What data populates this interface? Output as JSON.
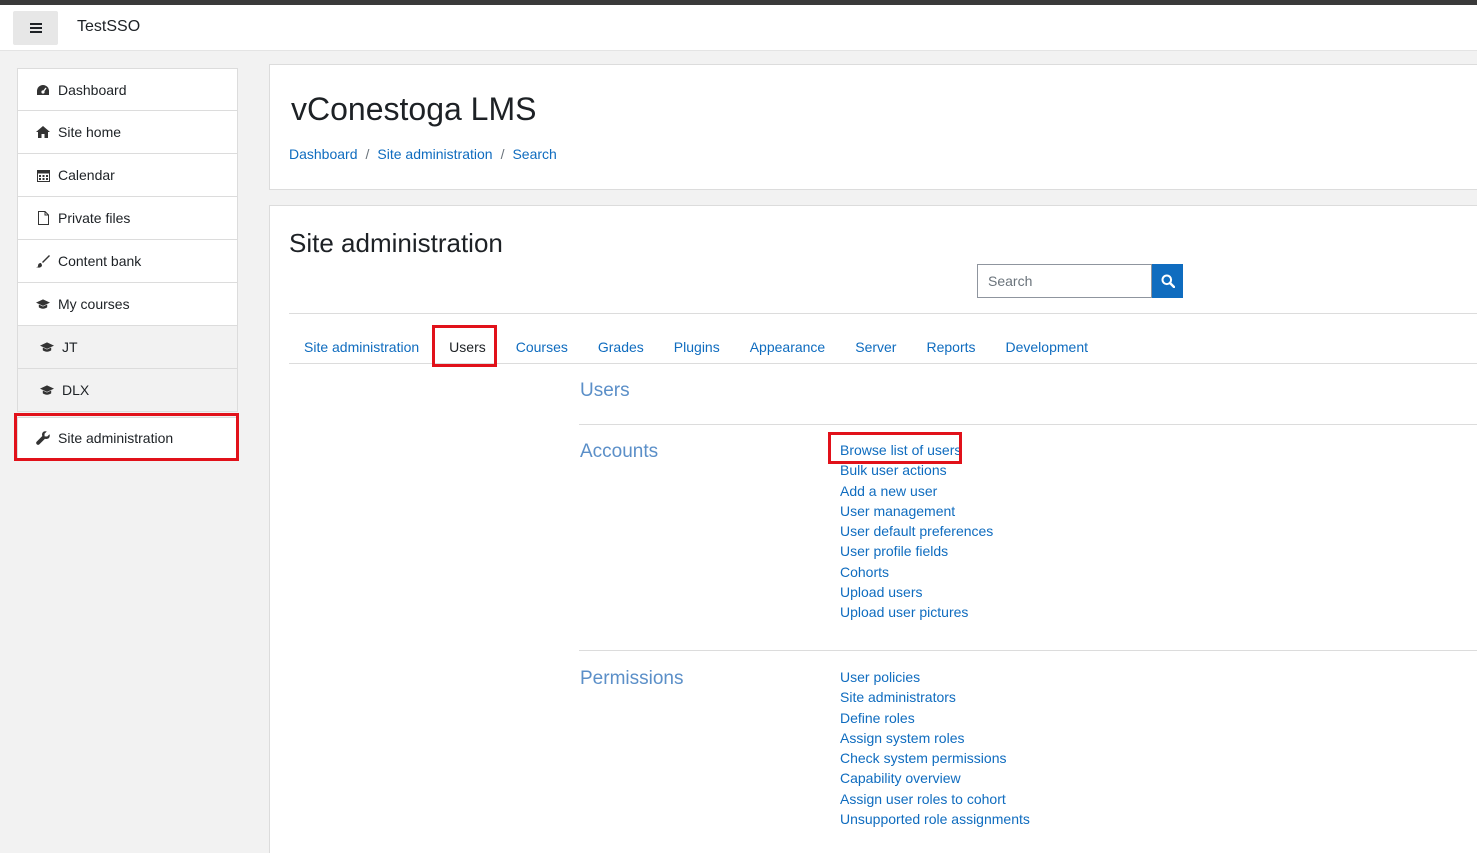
{
  "navbar": {
    "menu_icon": "hamburger-menu-icon",
    "site_name": "TestSSO"
  },
  "sidebar": {
    "items": [
      {
        "label": "Dashboard",
        "icon": "dashboard-icon"
      },
      {
        "label": "Site home",
        "icon": "home-icon"
      },
      {
        "label": "Calendar",
        "icon": "calendar-icon"
      },
      {
        "label": "Private files",
        "icon": "file-icon"
      },
      {
        "label": "Content bank",
        "icon": "paintbrush-icon"
      },
      {
        "label": "My courses",
        "icon": "graduation-cap-icon"
      },
      {
        "label": "JT",
        "icon": "graduation-cap-icon"
      },
      {
        "label": "DLX",
        "icon": "graduation-cap-icon"
      },
      {
        "label": "Site administration",
        "icon": "wrench-icon"
      }
    ]
  },
  "header": {
    "title": "vConestoga LMS",
    "breadcrumb": [
      "Dashboard",
      "Site administration",
      "Search"
    ]
  },
  "main": {
    "title": "Site administration",
    "search": {
      "placeholder": "Search",
      "button_icon": "search-icon"
    },
    "tabs": [
      {
        "label": "Site administration"
      },
      {
        "label": "Users",
        "active": true
      },
      {
        "label": "Courses"
      },
      {
        "label": "Grades"
      },
      {
        "label": "Plugins"
      },
      {
        "label": "Appearance"
      },
      {
        "label": "Server"
      },
      {
        "label": "Reports"
      },
      {
        "label": "Development"
      }
    ],
    "heading": "Users",
    "sections": [
      {
        "title": "Accounts",
        "links": [
          "Browse list of users",
          "Bulk user actions",
          "Add a new user",
          "User management",
          "User default preferences",
          "User profile fields",
          "Cohorts",
          "Upload users",
          "Upload user pictures"
        ]
      },
      {
        "title": "Permissions",
        "links": [
          "User policies",
          "Site administrators",
          "Define roles",
          "Assign system roles",
          "Check system permissions",
          "Capability overview",
          "Assign user roles to cohort",
          "Unsupported role assignments"
        ]
      }
    ]
  },
  "colors": {
    "link": "#0f6cbf",
    "section_title": "#5b8fc8",
    "highlight": "#e1111a"
  }
}
